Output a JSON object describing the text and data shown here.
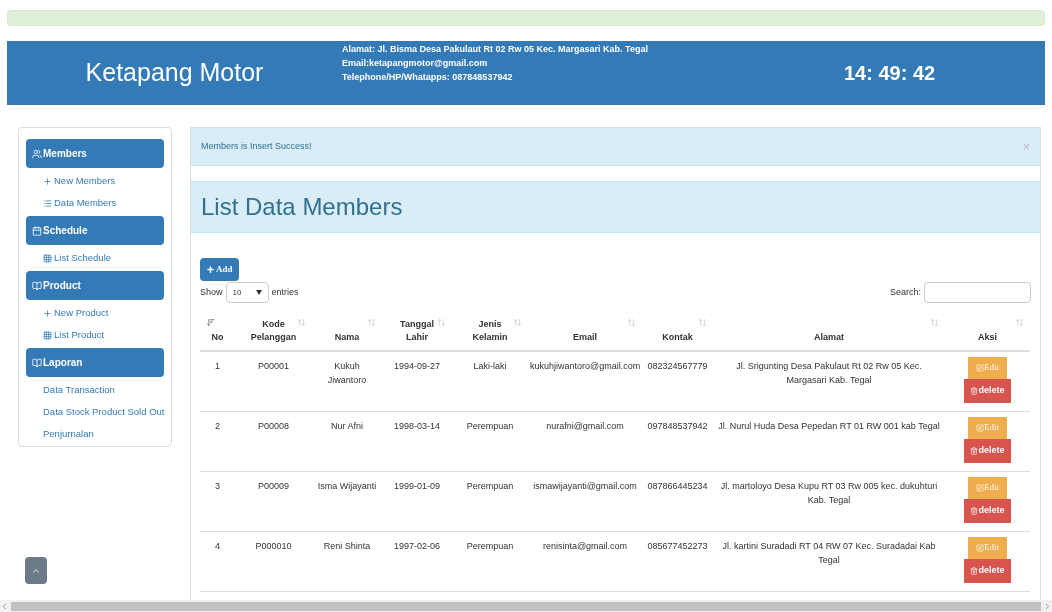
{
  "header": {
    "title": "Ketapang Motor",
    "address_lines": [
      "Alamat: Jl. Bisma Desa Pakulaut Rt 02 Rw 05 Kec. Margasari Kab. Tegal",
      "Email:ketapangmotor@gmail.com",
      "Telephone/HP/Whatapps: 087848537942"
    ],
    "clock": "14: 49: 42"
  },
  "sidebar": {
    "sections": [
      {
        "label": "Members",
        "items": [
          {
            "label": "New Members"
          },
          {
            "label": "Data Members"
          }
        ]
      },
      {
        "label": "Schedule",
        "items": [
          {
            "label": "List Schedule"
          }
        ]
      },
      {
        "label": "Product",
        "items": [
          {
            "label": "New Product"
          },
          {
            "label": "List Product"
          }
        ]
      },
      {
        "label": "Laporan",
        "items": [
          {
            "label": "Data Transaction"
          },
          {
            "label": "Data Stock Product Sold Out"
          },
          {
            "label": "Penjurnalan"
          }
        ]
      }
    ]
  },
  "alert": {
    "message": "Members is Insert Success!",
    "close": "×"
  },
  "page_title": "List Data Members",
  "add_button": "Add",
  "show": {
    "label": "Show",
    "value": "10",
    "suffix": "entries"
  },
  "search": {
    "label": "Search:"
  },
  "table": {
    "columns": [
      {
        "label": "No",
        "sorted": true
      },
      {
        "label": "Kode Pelanggan",
        "sorted": false
      },
      {
        "label": "Nama",
        "sorted": false
      },
      {
        "label": "Tanggal Lahir",
        "sorted": false
      },
      {
        "label": "Jenis Kelamin",
        "sorted": false
      },
      {
        "label": "Email",
        "sorted": false
      },
      {
        "label": "Kontak",
        "sorted": false
      },
      {
        "label": "Alamat",
        "sorted": false
      },
      {
        "label": "Aksi",
        "sorted": false
      }
    ],
    "rows": [
      {
        "cells": [
          "1",
          "P00001",
          "Kukuh Jiwantoro",
          "1994-09-27",
          "Laki-laki",
          "kukuhjiwantoro@gmail.com",
          "082324567779",
          "Jl. Srigunting Desa Pakulaut Rt 02 Rw 05 Kec. Margasari Kab. Tegal"
        ],
        "edit": "Edit",
        "delete": "delete"
      },
      {
        "cells": [
          "2",
          "P00008",
          "Nur Afni",
          "1998-03-14",
          "Perempuan",
          "nurafni@gmail.com",
          "097848537942",
          "Jl. Nurul Huda Desa Pepedan RT 01 RW 001 kab Tegal"
        ],
        "edit": "Edit",
        "delete": "delete"
      },
      {
        "cells": [
          "3",
          "P00009",
          "Isma Wijayanti",
          "1999-01-09",
          "Perempuan",
          "ismawijayanti@gmail.com",
          "087866445234",
          "Jl. martoloyo Desa Kupu RT 03 Rw 005 kec. dukuhturi Kab. Tegal"
        ],
        "edit": "Edit",
        "delete": "delete"
      },
      {
        "cells": [
          "4",
          "P000010",
          "Reni Shinta",
          "1997-02-06",
          "Perempuan",
          "renisinta@gmail.com",
          "085677452273",
          "Jl. kartini Suradadi RT 04 RW 07 Kec. Suradadai Kab Tegal"
        ],
        "edit": "Edit",
        "delete": "delete"
      }
    ]
  }
}
